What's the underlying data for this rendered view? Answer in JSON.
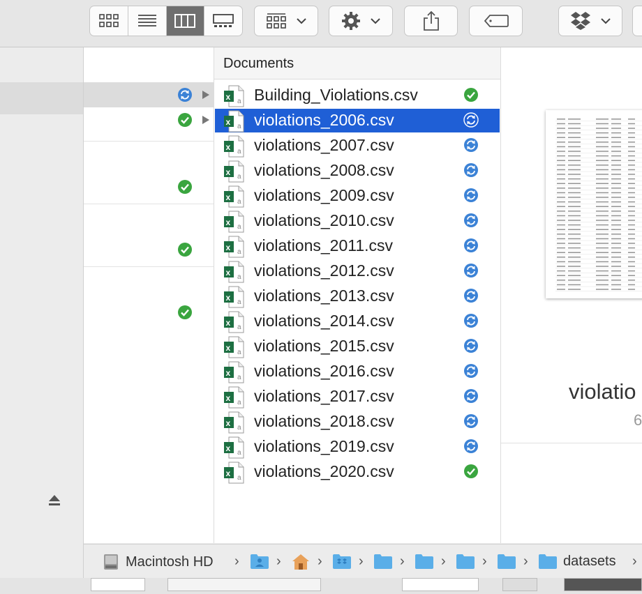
{
  "toolbar": {
    "view_buttons": [
      "icon-view",
      "list-view",
      "column-view",
      "gallery-view"
    ],
    "active_view": "column-view",
    "group_button": "group-by",
    "action_button": "action-gear",
    "share_button": "share",
    "tag_button": "tags",
    "dropbox_button": "dropbox"
  },
  "column1": {
    "rows": [
      {
        "status": "syncing",
        "has_arrow": true
      },
      {
        "status": "synced",
        "has_arrow": true
      },
      {
        "status": "synced",
        "has_arrow": false
      },
      {
        "status": "synced",
        "has_arrow": false
      },
      {
        "status": "synced",
        "has_arrow": false
      }
    ]
  },
  "documents": {
    "title": "Documents",
    "files": [
      {
        "name": "Building_Violations.csv",
        "status": "synced",
        "selected": false
      },
      {
        "name": "violations_2006.csv",
        "status": "syncing",
        "selected": true
      },
      {
        "name": "violations_2007.csv",
        "status": "syncing",
        "selected": false
      },
      {
        "name": "violations_2008.csv",
        "status": "syncing",
        "selected": false
      },
      {
        "name": "violations_2009.csv",
        "status": "syncing",
        "selected": false
      },
      {
        "name": "violations_2010.csv",
        "status": "syncing",
        "selected": false
      },
      {
        "name": "violations_2011.csv",
        "status": "syncing",
        "selected": false
      },
      {
        "name": "violations_2012.csv",
        "status": "syncing",
        "selected": false
      },
      {
        "name": "violations_2013.csv",
        "status": "syncing",
        "selected": false
      },
      {
        "name": "violations_2014.csv",
        "status": "syncing",
        "selected": false
      },
      {
        "name": "violations_2015.csv",
        "status": "syncing",
        "selected": false
      },
      {
        "name": "violations_2016.csv",
        "status": "syncing",
        "selected": false
      },
      {
        "name": "violations_2017.csv",
        "status": "syncing",
        "selected": false
      },
      {
        "name": "violations_2018.csv",
        "status": "syncing",
        "selected": false
      },
      {
        "name": "violations_2019.csv",
        "status": "syncing",
        "selected": false
      },
      {
        "name": "violations_2020.csv",
        "status": "synced",
        "selected": false
      }
    ]
  },
  "preview": {
    "name": "violatio",
    "subtext": "6"
  },
  "pathbar": {
    "drive": "Macintosh HD",
    "last_folder": "datasets",
    "folder_icons": [
      "user-folder-icon",
      "home-icon",
      "dropbox-folder-icon",
      "folder-icon",
      "folder-icon",
      "folder-icon",
      "folder-icon",
      "folder-icon"
    ]
  },
  "colors": {
    "selection": "#1f5fd6",
    "synced": "#3aa53f",
    "syncing": "#3b82d6",
    "excel_green": "#1d6f42",
    "folder_blue": "#5aaee8"
  }
}
